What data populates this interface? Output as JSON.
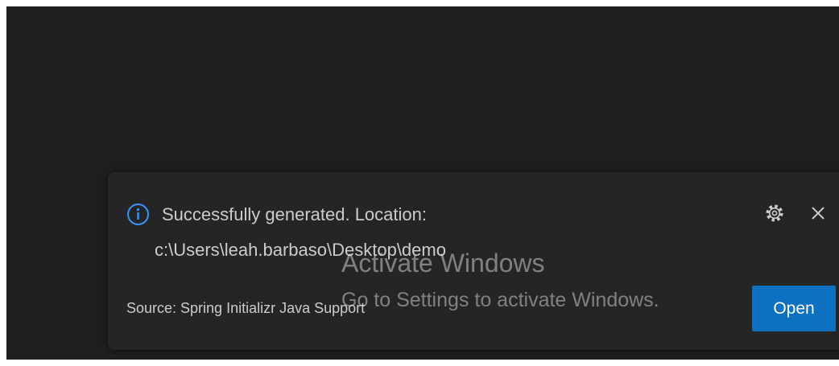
{
  "notification": {
    "message": "Successfully generated. Location:",
    "path": "c:\\Users\\leah.barbaso\\Desktop\\demo",
    "source": "Source: Spring Initializr Java Support",
    "open_label": "Open",
    "info_icon": "info-icon",
    "settings_icon": "gear-icon",
    "close_icon": "close-icon"
  },
  "watermark": {
    "title": "Activate Windows",
    "subtitle": "Go to Settings to activate Windows."
  },
  "colors": {
    "background": "#1f1f1f",
    "toast_background": "#252526",
    "text": "#cccccc",
    "accent": "#0e70c0",
    "info_icon": "#3794ff"
  }
}
